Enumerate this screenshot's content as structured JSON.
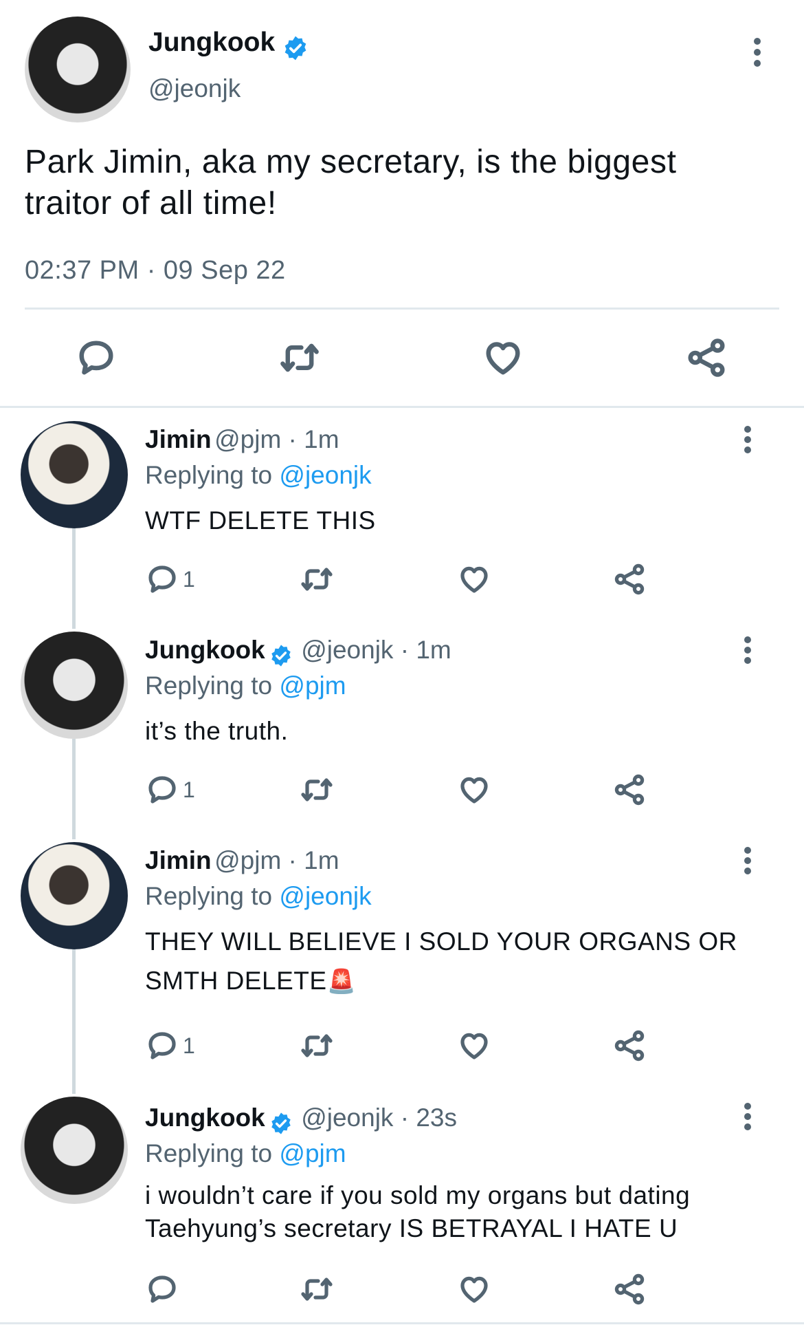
{
  "main_tweet": {
    "name": "Jungkook",
    "handle": "@jeonjk",
    "text_line1": "Park Jimin, aka my secretary, is the biggest",
    "text_line2": "traitor of all time!",
    "timestamp": "02:37 PM · 09 Sep 22"
  },
  "replies": [
    {
      "name": "Jimin",
      "handle_time": "@pjm · 1m",
      "replying_label": "Replying to",
      "replying_to": "@jeonjk",
      "text_line1": "WTF DELETE THIS",
      "reply_count": "1"
    },
    {
      "name": "Jungkook",
      "handle_time": "@jeonjk · 1m",
      "replying_label": "Replying to",
      "replying_to": "@pjm",
      "text_line1": "it’s the truth.",
      "reply_count": "1"
    },
    {
      "name": "Jimin",
      "handle_time": "@pjm · 1m",
      "replying_label": "Replying to",
      "replying_to": "@jeonjk",
      "text_line1": "THEY WILL BELIEVE I SOLD YOUR ORGANS OR",
      "text_line2": "SMTH DELETE",
      "emoji": "🚨",
      "reply_count": "1"
    },
    {
      "name": "Jungkook",
      "handle_time": "@jeonjk · 23s",
      "replying_label": "Replying to",
      "replying_to": "@pjm",
      "text_line1": "i wouldn’t care if you sold my organs but dating",
      "text_line2": "Taehyung’s secretary IS BETRAYAL I HATE U",
      "reply_count": ""
    }
  ],
  "colors": {
    "accent": "#1d9bf0",
    "muted": "#536471",
    "divider": "#e1e8ed"
  }
}
